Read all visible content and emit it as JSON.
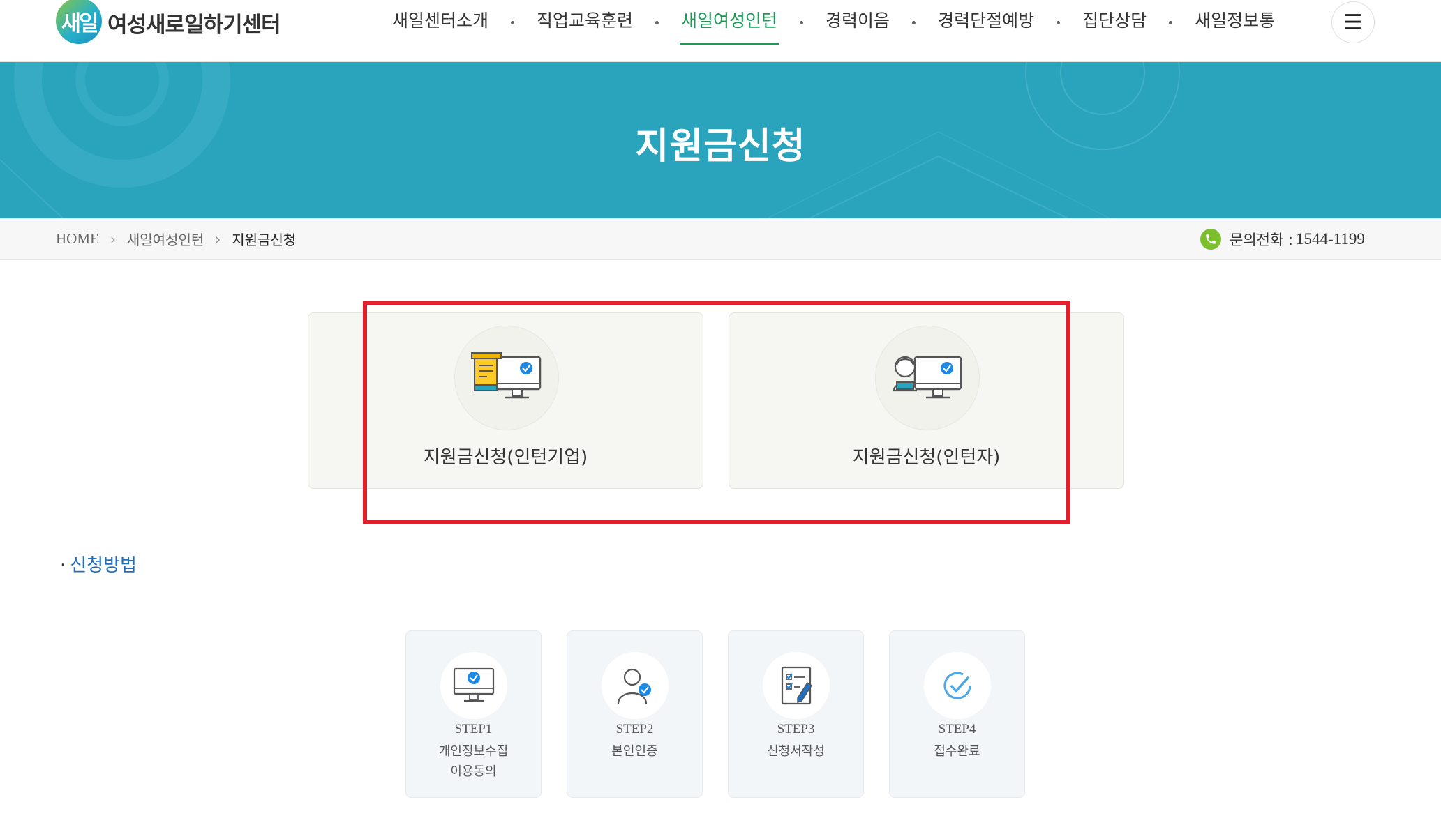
{
  "header": {
    "logo_mark": "새일",
    "logo_text": "여성새로일하기센터",
    "nav": [
      {
        "label": "새일센터소개",
        "active": false
      },
      {
        "label": "직업교육훈련",
        "active": false
      },
      {
        "label": "새일여성인턴",
        "active": true
      },
      {
        "label": "경력이음",
        "active": false
      },
      {
        "label": "경력단절예방",
        "active": false
      },
      {
        "label": "집단상담",
        "active": false
      },
      {
        "label": "새일정보통",
        "active": false
      }
    ],
    "menu_icon": "hamburger-icon",
    "accent": "#1f9a5a"
  },
  "banner": {
    "title": "지원금신청",
    "color": "#2aa3bd"
  },
  "breadcrumb": {
    "home": "HOME",
    "parent": "새일여성인턴",
    "current": "지원금신청"
  },
  "contact": {
    "label": "문의전화 :",
    "number": "1544-1199"
  },
  "apply_cards": [
    {
      "label": "지원금신청(인턴기업)",
      "icon": "company-monitor-icon"
    },
    {
      "label": "지원금신청(인턴자)",
      "icon": "person-monitor-icon"
    }
  ],
  "section": {
    "bullet": "·",
    "title": "신청방법"
  },
  "steps": [
    {
      "num": "STEP1",
      "line1": "개인정보수집",
      "line2": "이용동의",
      "icon": "monitor-check-icon"
    },
    {
      "num": "STEP2",
      "line1": "본인인증",
      "line2": "",
      "icon": "user-check-icon"
    },
    {
      "num": "STEP3",
      "line1": "신청서작성",
      "line2": "",
      "icon": "form-pen-icon"
    },
    {
      "num": "STEP4",
      "line1": "접수완료",
      "line2": "",
      "icon": "check-circle-icon"
    }
  ],
  "highlight_color": "#e0202a"
}
